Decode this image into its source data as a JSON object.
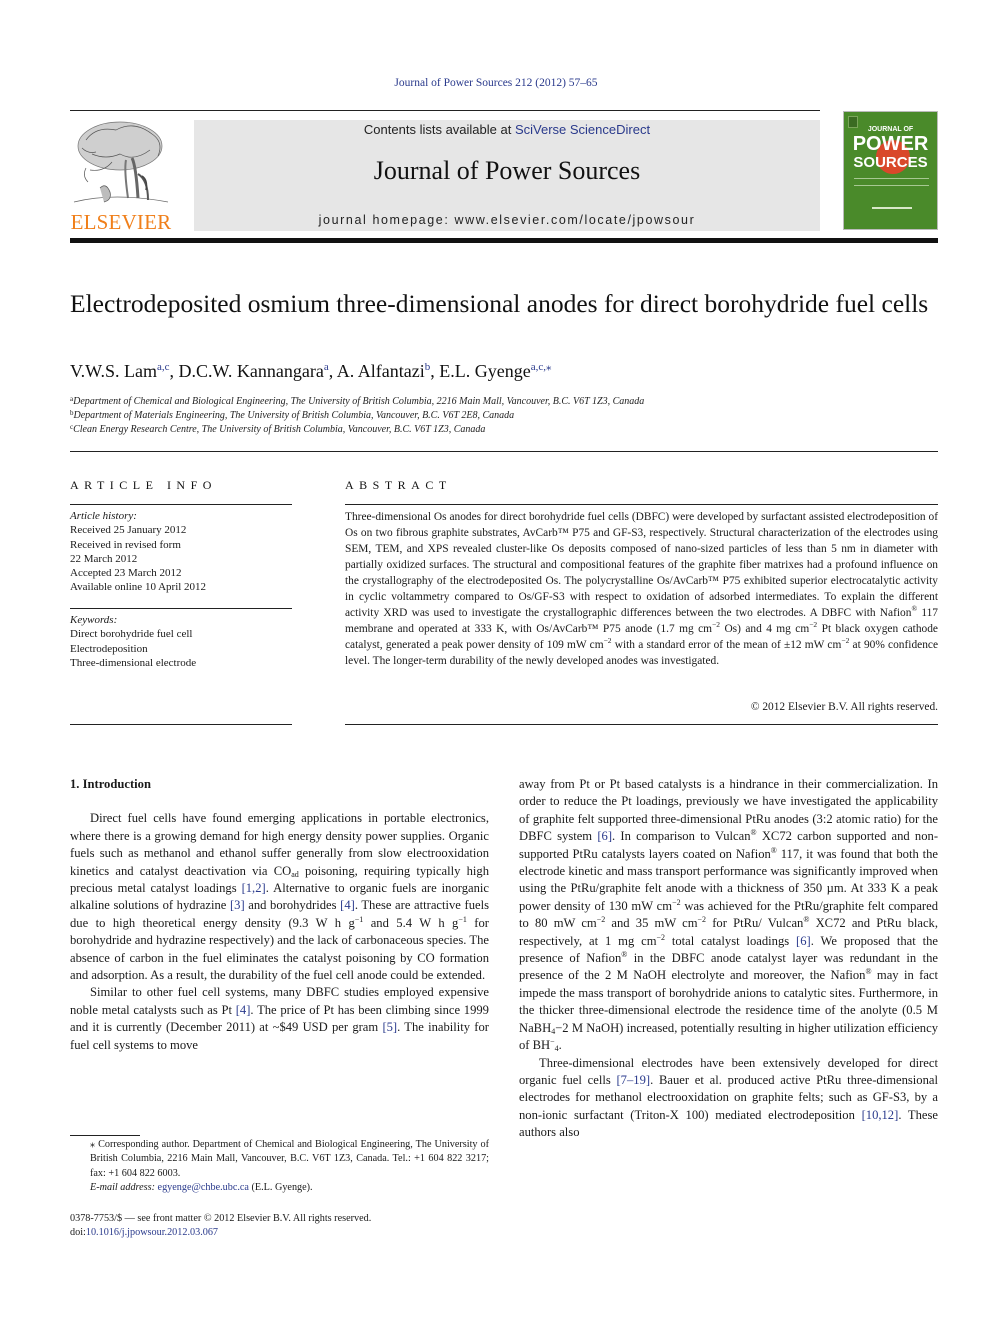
{
  "citation": "Journal of Power Sources 212 (2012) 57–65",
  "masthead": {
    "publisher_logo_text": "ELSEVIER",
    "contents_prefix": "Contents lists available at ",
    "contents_link": "SciVerse ScienceDirect",
    "journal_name": "Journal of Power Sources",
    "homepage": "journal homepage: www.elsevier.com/locate/jpowsour",
    "cover": {
      "line1": "JOURNAL OF",
      "line2": "POWER",
      "line3": "SOURCES"
    }
  },
  "colors": {
    "link": "#2a3a8c",
    "elsevier_orange": "#f07f1a",
    "cover_green": "#4a8a2a",
    "masthead_bg": "#e6e6e6"
  },
  "article": {
    "title": "Electrodeposited osmium three-dimensional anodes for direct borohydride fuel cells",
    "authors": [
      {
        "name": "V.W.S. Lam",
        "sup": "a,c",
        "sep": ", "
      },
      {
        "name": "D.C.W. Kannangara",
        "sup": "a",
        "sep": ", "
      },
      {
        "name": "A. Alfantazi",
        "sup": "b",
        "sep": ", "
      },
      {
        "name": "E.L. Gyenge",
        "sup": "a,c,⁎",
        "sep": ""
      }
    ],
    "affiliations": [
      {
        "key": "a",
        "text": "Department of Chemical and Biological Engineering, The University of British Columbia, 2216 Main Mall, Vancouver, B.C. V6T 1Z3, Canada"
      },
      {
        "key": "b",
        "text": "Department of Materials Engineering, The University of British Columbia, Vancouver, B.C. V6T 2E8, Canada"
      },
      {
        "key": "c",
        "text": "Clean Energy Research Centre, The University of British Columbia, Vancouver, B.C. V6T 1Z3, Canada"
      }
    ]
  },
  "article_info": {
    "heading": "ARTICLE INFO",
    "history_label": "Article history:",
    "history": [
      "Received 25 January 2012",
      "Received in revised form",
      "22 March 2012",
      "Accepted 23 March 2012",
      "Available online 10 April 2012"
    ],
    "keywords_label": "Keywords:",
    "keywords": [
      "Direct borohydride fuel cell",
      "Electrodeposition",
      "Three-dimensional electrode"
    ]
  },
  "abstract": {
    "heading": "ABSTRACT",
    "p1": "Three-dimensional Os anodes for direct borohydride fuel cells (DBFC) were developed by surfactant assisted electrodeposition of Os on two fibrous graphite substrates, AvCarb™ P75 and GF-S3, respectively. Structural characterization of the electrodes using SEM, TEM, and XPS revealed cluster-like Os deposits composed of nano-sized particles of less than 5 nm in diameter with partially oxidized surfaces. The structural and compositional features of the graphite fiber matrixes had a profound influence on the crystallography of the electrodeposited Os. The polycrystalline Os/AvCarb™ P75 exhibited superior electrocatalytic activity in cyclic voltammetry compared to Os/GF-S3 with respect to oxidation of adsorbed intermediates. To explain the different activity XRD was used to investigate the crystallographic differences between the two electrodes. A DBFC with Nafion",
    "p2": " 117 membrane and operated at 333 K, with Os/AvCarb™ P75 anode (1.7 mg cm",
    "p3": " Os) and 4 mg cm",
    "p4": " Pt black oxygen cathode catalyst, generated a peak power density of 109 mW cm",
    "p5": " with a standard error of the mean of ±12 mW cm",
    "p6": " at 90% confidence level. The longer-term durability of the newly developed anodes was investigated.",
    "reg": "®",
    "neg2": "−2",
    "copyright": "© 2012 Elsevier B.V. All rights reserved."
  },
  "body": {
    "section_heading": "1.  Introduction",
    "left": {
      "para1_a": "Direct fuel cells have found emerging applications in portable electronics, where there is a growing demand for high energy density power supplies. Organic fuels such as methanol and ethanol suffer generally from slow electrooxidation kinetics and catalyst deactivation via CO",
      "para1_sub": "ad",
      "para1_b": " poisoning, requiring typically high precious metal catalyst loadings ",
      "ref_1_2": "[1,2]",
      "para1_c": ". Alternative to organic fuels are inorganic alkaline solutions of hydrazine ",
      "ref_3": "[3]",
      "para1_d": " and borohydrides ",
      "ref_4": "[4]",
      "para1_e": ". These are attractive fuels due to high theoretical energy density (9.3 W h g",
      "neg1": "−1",
      "para1_f": " and 5.4 W h g",
      "para1_g": " for borohydride and hydrazine respectively) and the lack of carbonaceous species. The absence of carbon in the fuel eliminates the catalyst poisoning by CO formation and adsorption. As a result, the durability of the fuel cell anode could be extended.",
      "para2_a": "Similar to other fuel cell systems, many DBFC studies employed expensive noble metal catalysts such as Pt ",
      "ref_4b": "[4]",
      "para2_b": ". The price of Pt has been climbing since 1999 and it is currently (December 2011) at ~$49 USD per gram ",
      "ref_5": "[5]",
      "para2_c": ". The inability for fuel cell systems to move"
    },
    "right": {
      "para1_a": "away from Pt or Pt based catalysts is a hindrance in their commercialization. In order to reduce the Pt loadings, previously we have investigated the applicability of graphite felt supported three-dimensional PtRu anodes (3:2 atomic ratio) for the DBFC system ",
      "ref_6": "[6]",
      "para1_b": ". In comparison to Vulcan",
      "para1_c": " XC72 carbon supported and non-supported PtRu catalysts layers coated on Nafion",
      "para1_d": " 117, it was found that both the electrode kinetic and mass transport performance was significantly improved when using the PtRu/graphite felt anode with a thickness of 350 µm. At 333 K a peak power density of 130 mW cm",
      "para1_e": " was achieved for the PtRu/graphite felt compared to 80 mW cm",
      "para1_f": " and 35 mW cm",
      "para1_g": " for PtRu/ Vulcan",
      "para1_h": " XC72 and PtRu black, respectively, at 1 mg cm",
      "para1_i": " total catalyst loadings ",
      "ref_6b": "[6]",
      "para1_j": ". We proposed that the presence of Nafion",
      "para1_k": " in the DBFC anode catalyst layer was redundant in the presence of the 2 M NaOH electrolyte and moreover, the Nafion",
      "para1_l": " may in fact impede the mass transport of borohydride anions to catalytic sites. Furthermore, in the thicker three-dimensional electrode the residence time of the anolyte (0.5 M NaBH",
      "sub4": "4",
      "para1_m": "−2 M NaOH) increased, potentially resulting in higher utilization efficiency of BH",
      "minus_sup": "−",
      "para1_n": ".",
      "para2_a": "Three-dimensional electrodes have been extensively developed for direct organic fuel cells ",
      "ref_7_19": "[7–19]",
      "para2_b": ". Bauer et al. produced active PtRu three-dimensional electrodes for methanol electrooxidation on graphite felts; such as GF-S3, by a non-ionic surfactant (Triton-X 100) mediated electrodeposition ",
      "ref_10_12": "[10,12]",
      "para2_c": ". These authors also"
    }
  },
  "footnote": {
    "star": "⁎",
    "corresponding": " Corresponding author. Department of Chemical and Biological Engineering, The University of British Columbia, 2216 Main Mall, Vancouver, B.C. V6T 1Z3, Canada. Tel.: +1 604 822 3217; fax: +1 604 822 6003.",
    "email_label": "E-mail address: ",
    "email": "egyenge@chbe.ubc.ca",
    "email_suffix": " (E.L. Gyenge)."
  },
  "frontmatter": {
    "issn_line": "0378-7753/$ — see front matter © 2012 Elsevier B.V. All rights reserved.",
    "doi_label": "doi:",
    "doi": "10.1016/j.jpowsour.2012.03.067"
  }
}
